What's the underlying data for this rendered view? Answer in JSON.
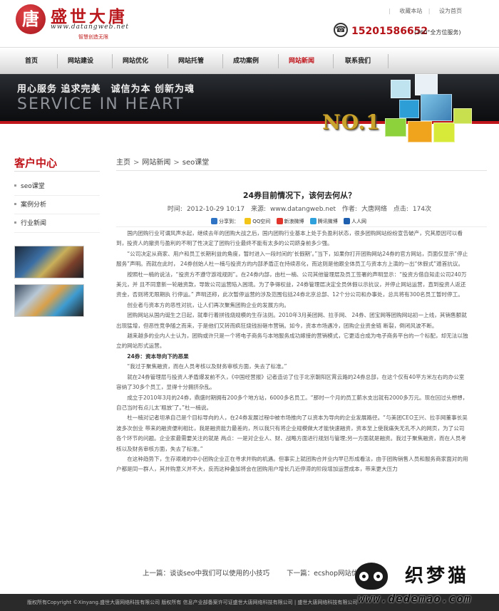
{
  "header": {
    "logo_glyph": "唐",
    "logo_name": "盛世大唐",
    "logo_url": "www.datangweb.net",
    "logo_slogan": "智慧创造无限",
    "toplinks": [
      "收藏本站",
      "设为首页"
    ],
    "phone": "15201586652",
    "phone_note": "(360°全方位服务)"
  },
  "nav": {
    "items": [
      "首页",
      "网站建设",
      "网站优化",
      "网站托管",
      "成功案例",
      "网站新闻",
      "联系我们"
    ],
    "active_index": 5
  },
  "banner": {
    "slogan_cn": "用心服务 追求完美　诚信为本 创新为魂",
    "slogan_en": "SERVICE IN HEART",
    "badge": "NO.1"
  },
  "sidebar": {
    "title": "客户中心",
    "items": [
      "seo课堂",
      "案例分析",
      "行业新闻"
    ]
  },
  "breadcrumb": [
    "主页",
    "网站新闻",
    "seo课堂"
  ],
  "article": {
    "title": "24券目前情况下，该何去何从？",
    "meta": {
      "time_label": "时间:",
      "time": "2012-10-29 10:17",
      "source_label": "来源:",
      "source": "www.datangweb.net",
      "author_label": "作者:",
      "author": "大唐网络",
      "clicks_label": "点击:",
      "clicks": "174次"
    },
    "share": {
      "label": "分享到：",
      "items": [
        "QQ空间",
        "新浪微博",
        "腾讯微博",
        "人人网"
      ]
    },
    "paragraphs": [
      "国内团购行业可谓风声水起，继续去年的团购大战之后，国内团购行业基本上处于负盈利状态，很多团购网站纷纷宣告破产，究其原因可以看到，投资人的撤资与盈利的不明了性决定了团购行业最终不能有太多的公司跻身前多少强。",
      "“公司决定从商家、用户和员工长期利益的角度，暂时进入一段时间的‘长假期’。”当下，如果你打开团购网站24券的官方网站，页面仅显示“停止服务”声明。而就在此时， 24券创始人杜一楠与投资方的内部矛盾正在持续恶化，而这则是他跟全体员工与资本方上演的一出“休假式”遁首抗议。",
      "按照杜一楠的说法，“投资方不遵守游戏规则”。在24券内部，由杜一楠、公司其他管理层及员工签署的声明显示：“投资方借自知走公司240万美元，并 且不同意新一轮融资款，导致公司运营陷入困境。为了争得权益，24券管理层决定全员休假以示抗议，并停止网站运营，直到投资人返还资金，否则将无限期执 行停运。” 声明还称，此次暂停运营的涉及范围包括24券北京总部、12个分公司和办事处，总共将有300名员工暂时停工。",
      "创业者与资本方的恶性对抗，让人们再次聚焦团购企业的发展方向。",
      "团购网站从国内诞生之日起，就奉行着拼钱烧规模的生存法则。2010年3月美团网、拉手网、 24券、团宝网等团购网站初一上线，其销售额就出现猛增，但恶性竞争随之而来，于是他们又转而疯狂烧钱扮砸市营销。如今，资本市场遇冷，团购企业资金链 断裂，倒闭风波不断。",
      "越来越多的业内人士认为，团购或许只是一个将电子商务与本地服务成功嫁接的营销模式，它更适合成为电子商务平台的一个标配，却无法以独立的网站形式运营。",
      "24券：资本导向下的恶果",
      "“我过于聚焦融资，而在人员考核以及财务审核方面，失去了标准。”",
      "就在24券管理层与投资人矛盾爆发前不久，《中国经营报》记者造访了位于北京朝阳区霄云路的24券总部，在这个仅有40平方米左右的办公室容纳了30多个员工，显得十分拥挤杂乱。",
      "成立于2010年3月的24券，鼎盛时期拥有200多个地方站，6000多名员工。“那时一个月的员工薪水支出就有2000多万元。现在回过头想想，自己当时有点儿太‘粗放’了。”杜一楠说。",
      "杜一楠对记者坦承自己是个目标导向的人，在24券发展过程中被市场推向了以资本为导向的企业发展路径。“与美团CEO王兴、拉手网董事长吴波多次创业 带来的融资便利相比，我是融资能力最差的，所以我只有将企业规模做大才能快速融资，资本至上使我痛失无孔不入的网页，为了公司各个环节的问题。企业家最需要关注的就是 两点：一是对企业人、财、战略方面进行规划与管理;另一方面就是融资。我过于聚焦融资，而在人员考核以及财务审核方面，失去了标准。”",
      "在这种趋势下，生存艰难的中小团购企业正在寻求并购的机遇。但事实上就团购合并业内早已形成看法，由于团购销售人员和服务商家面对的用户都是同一群人，其并购意义并不大，反而这种叠加将会在团购用户增长几近停滞的阶段增加运营成本，带来更大压力"
    ],
    "strong_index": 6
  },
  "prevnext": {
    "prev": "上一篇：谈谈seo中我们可以使用的小技巧",
    "next": "下一篇：ecshop网站优化"
  },
  "footer": {
    "text": "版权所有Copyright ©Xinyang.盛世大唐网络科技有限公司 版权所有 信息产业部备案许可证盛世大唐网络科技有限公司 | 盛世大唐网络科技有限公司"
  },
  "watermark": {
    "name": "织梦猫",
    "url": "www.dedemao.com"
  },
  "colors": {
    "brand_red": "#c0151b",
    "nav_bg": "#e8e8e8",
    "banner_bg": "#15171a",
    "footer_bg": "#2a2a2a"
  }
}
